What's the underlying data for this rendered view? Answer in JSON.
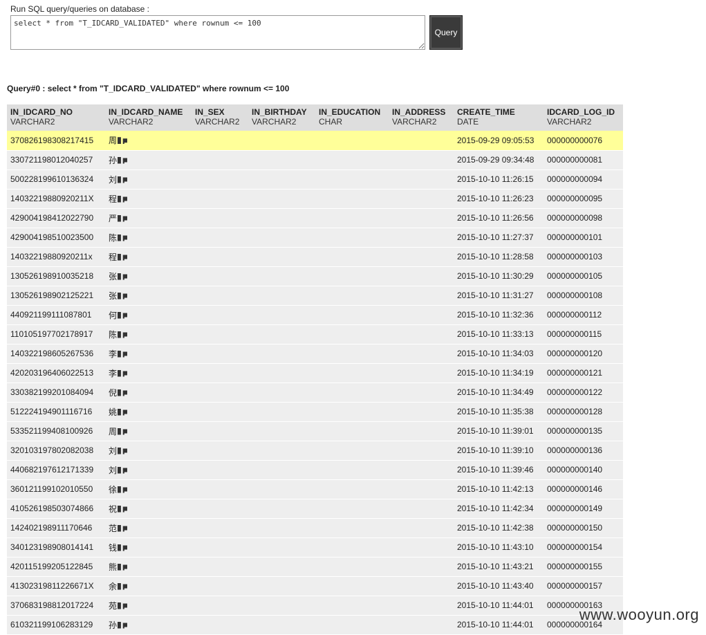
{
  "form": {
    "label": "Run SQL query/queries on database :",
    "sql": "select * from \"T_IDCARD_VALIDATED\" where rownum <= 100",
    "button": "Query"
  },
  "result": {
    "title": "Query#0 : select * from \"T_IDCARD_VALIDATED\" where rownum <= 100",
    "columns": [
      {
        "name": "IN_IDCARD_NO",
        "type": "VARCHAR2"
      },
      {
        "name": "IN_IDCARD_NAME",
        "type": "VARCHAR2"
      },
      {
        "name": "IN_SEX",
        "type": "VARCHAR2"
      },
      {
        "name": "IN_BIRTHDAY",
        "type": "VARCHAR2"
      },
      {
        "name": "IN_EDUCATION",
        "type": "CHAR"
      },
      {
        "name": "IN_ADDRESS",
        "type": "VARCHAR2"
      },
      {
        "name": "CREATE_TIME",
        "type": "DATE"
      },
      {
        "name": "IDCARD_LOG_ID",
        "type": "VARCHAR2"
      }
    ],
    "rows": [
      {
        "id": "370826198308217415",
        "name": "周",
        "time": "2015-09-29 09:05:53",
        "log": "000000000076"
      },
      {
        "id": "330721198012040257",
        "name": "孙",
        "time": "2015-09-29 09:34:48",
        "log": "000000000081"
      },
      {
        "id": "500228199610136324",
        "name": "刘",
        "time": "2015-10-10 11:26:15",
        "log": "000000000094"
      },
      {
        "id": "14032219880920211X",
        "name": "程",
        "time": "2015-10-10 11:26:23",
        "log": "000000000095"
      },
      {
        "id": "429004198412022790",
        "name": "严",
        "time": "2015-10-10 11:26:56",
        "log": "000000000098"
      },
      {
        "id": "429004198510023500",
        "name": "陈",
        "time": "2015-10-10 11:27:37",
        "log": "000000000101"
      },
      {
        "id": "14032219880920211x",
        "name": "程",
        "time": "2015-10-10 11:28:58",
        "log": "000000000103"
      },
      {
        "id": "130526198910035218",
        "name": "张",
        "time": "2015-10-10 11:30:29",
        "log": "000000000105"
      },
      {
        "id": "130526198902125221",
        "name": "张",
        "time": "2015-10-10 11:31:27",
        "log": "000000000108"
      },
      {
        "id": "440921199111087801",
        "name": "何",
        "time": "2015-10-10 11:32:36",
        "log": "000000000112"
      },
      {
        "id": "110105197702178917",
        "name": "陈",
        "time": "2015-10-10 11:33:13",
        "log": "000000000115"
      },
      {
        "id": "140322198605267536",
        "name": "李",
        "time": "2015-10-10 11:34:03",
        "log": "000000000120"
      },
      {
        "id": "420203196406022513",
        "name": "李",
        "time": "2015-10-10 11:34:19",
        "log": "000000000121"
      },
      {
        "id": "330382199201084094",
        "name": "倪",
        "time": "2015-10-10 11:34:49",
        "log": "000000000122"
      },
      {
        "id": "512224194901116716",
        "name": "姚",
        "time": "2015-10-10 11:35:38",
        "log": "000000000128"
      },
      {
        "id": "533521199408100926",
        "name": "周",
        "time": "2015-10-10 11:39:01",
        "log": "000000000135"
      },
      {
        "id": "320103197802082038",
        "name": "刘",
        "time": "2015-10-10 11:39:10",
        "log": "000000000136"
      },
      {
        "id": "440682197612171339",
        "name": "刘",
        "time": "2015-10-10 11:39:46",
        "log": "000000000140"
      },
      {
        "id": "360121199102010550",
        "name": "徐",
        "time": "2015-10-10 11:42:13",
        "log": "000000000146"
      },
      {
        "id": "410526198503074866",
        "name": "祝",
        "time": "2015-10-10 11:42:34",
        "log": "000000000149"
      },
      {
        "id": "142402198911170646",
        "name": "范",
        "time": "2015-10-10 11:42:38",
        "log": "000000000150"
      },
      {
        "id": "340123198908014141",
        "name": "钱",
        "time": "2015-10-10 11:43:10",
        "log": "000000000154"
      },
      {
        "id": "420115199205122845",
        "name": "熊",
        "time": "2015-10-10 11:43:21",
        "log": "000000000155"
      },
      {
        "id": "41302319811226671X",
        "name": "余",
        "time": "2015-10-10 11:43:40",
        "log": "000000000157"
      },
      {
        "id": "370683198812017224",
        "name": "苑",
        "time": "2015-10-10 11:44:01",
        "log": "000000000163"
      },
      {
        "id": "610321199106283129",
        "name": "孙",
        "time": "2015-10-10 11:44:01",
        "log": "000000000164"
      }
    ]
  },
  "watermark": "www.wooyun.org",
  "colors": {
    "highlight": "#ffff99",
    "header_bg": "#dedede",
    "row_bg": "#eeeeee",
    "button_bg": "#3a3a3a"
  }
}
